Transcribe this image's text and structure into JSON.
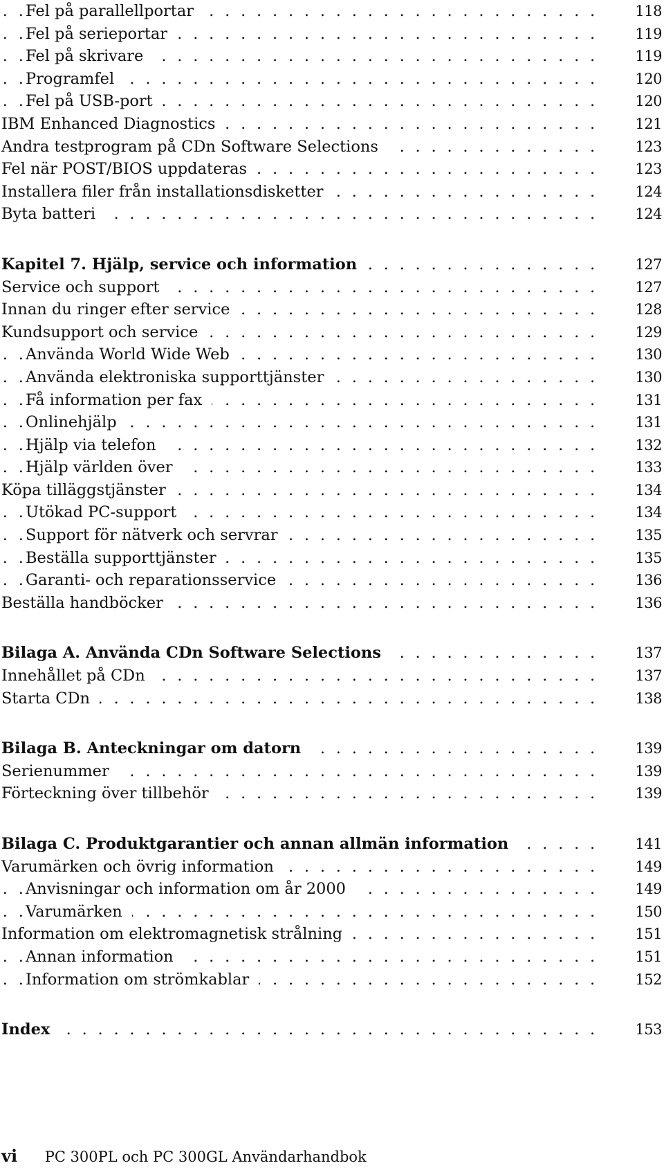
{
  "toc": {
    "entries": [
      {
        "title": "Fel på parallellportar",
        "page": "118",
        "level": 2,
        "heading": false,
        "gap_before": false
      },
      {
        "title": "Fel på serieportar",
        "page": "119",
        "level": 2,
        "heading": false,
        "gap_before": false
      },
      {
        "title": "Fel på skrivare",
        "page": "119",
        "level": 2,
        "heading": false,
        "gap_before": false
      },
      {
        "title": "Programfel",
        "page": "120",
        "level": 2,
        "heading": false,
        "gap_before": false
      },
      {
        "title": "Fel på USB-port",
        "page": "120",
        "level": 2,
        "heading": false,
        "gap_before": false
      },
      {
        "title": "IBM Enhanced Diagnostics",
        "page": "121",
        "level": 1,
        "heading": false,
        "gap_before": false
      },
      {
        "title": "Andra testprogram på CDn Software Selections",
        "page": "123",
        "level": 1,
        "heading": false,
        "gap_before": false
      },
      {
        "title": "Fel när POST/BIOS uppdateras",
        "page": "123",
        "level": 1,
        "heading": false,
        "gap_before": false
      },
      {
        "title": "Installera filer från installationsdisketter",
        "page": "124",
        "level": 1,
        "heading": false,
        "gap_before": false
      },
      {
        "title": "Byta batteri",
        "page": "124",
        "level": 1,
        "heading": false,
        "gap_before": false
      },
      {
        "title": "Kapitel 7.  Hjälp, service och information",
        "page": "127",
        "level": 1,
        "heading": true,
        "gap_before": true
      },
      {
        "title": "Service och support",
        "page": "127",
        "level": 1,
        "heading": false,
        "gap_before": false
      },
      {
        "title": "Innan du ringer efter service",
        "page": "128",
        "level": 1,
        "heading": false,
        "gap_before": false
      },
      {
        "title": "Kundsupport och service",
        "page": "129",
        "level": 1,
        "heading": false,
        "gap_before": false
      },
      {
        "title": "Använda World Wide Web",
        "page": "130",
        "level": 2,
        "heading": false,
        "gap_before": false
      },
      {
        "title": "Använda elektroniska supporttjänster",
        "page": "130",
        "level": 2,
        "heading": false,
        "gap_before": false
      },
      {
        "title": "Få information per fax",
        "page": "131",
        "level": 2,
        "heading": false,
        "gap_before": false
      },
      {
        "title": "Onlinehjälp",
        "page": "131",
        "level": 2,
        "heading": false,
        "gap_before": false
      },
      {
        "title": "Hjälp via telefon",
        "page": "132",
        "level": 2,
        "heading": false,
        "gap_before": false
      },
      {
        "title": "Hjälp världen över",
        "page": "133",
        "level": 2,
        "heading": false,
        "gap_before": false
      },
      {
        "title": "Köpa tilläggstjänster",
        "page": "134",
        "level": 1,
        "heading": false,
        "gap_before": false
      },
      {
        "title": "Utökad PC-support",
        "page": "134",
        "level": 2,
        "heading": false,
        "gap_before": false
      },
      {
        "title": "Support för nätverk och servrar",
        "page": "135",
        "level": 2,
        "heading": false,
        "gap_before": false
      },
      {
        "title": "Beställa supporttjänster",
        "page": "135",
        "level": 2,
        "heading": false,
        "gap_before": false
      },
      {
        "title": "Garanti- och reparationsservice",
        "page": "136",
        "level": 2,
        "heading": false,
        "gap_before": false
      },
      {
        "title": "Beställa handböcker",
        "page": "136",
        "level": 1,
        "heading": false,
        "gap_before": false
      },
      {
        "title": "Bilaga A.  Använda CDn Software Selections",
        "page": "137",
        "level": 1,
        "heading": true,
        "gap_before": true
      },
      {
        "title": "Innehållet på CDn",
        "page": "137",
        "level": 1,
        "heading": false,
        "gap_before": false
      },
      {
        "title": "Starta CDn",
        "page": "138",
        "level": 1,
        "heading": false,
        "gap_before": false
      },
      {
        "title": "Bilaga B.  Anteckningar om datorn",
        "page": "139",
        "level": 1,
        "heading": true,
        "gap_before": true
      },
      {
        "title": "Serienummer",
        "page": "139",
        "level": 1,
        "heading": false,
        "gap_before": false
      },
      {
        "title": "Förteckning över tillbehör",
        "page": "139",
        "level": 1,
        "heading": false,
        "gap_before": false
      },
      {
        "title": "Bilaga C.  Produktgarantier och annan allmän information",
        "page": "141",
        "level": 1,
        "heading": true,
        "gap_before": true
      },
      {
        "title": "Varumärken och övrig information",
        "page": "149",
        "level": 1,
        "heading": false,
        "gap_before": false
      },
      {
        "title": "Anvisningar och information om år 2000",
        "page": "149",
        "level": 2,
        "heading": false,
        "gap_before": false
      },
      {
        "title": "Varumärken",
        "page": "150",
        "level": 2,
        "heading": false,
        "gap_before": false
      },
      {
        "title": "Information om elektromagnetisk strålning",
        "page": "151",
        "level": 1,
        "heading": false,
        "gap_before": false
      },
      {
        "title": "Annan information",
        "page": "151",
        "level": 2,
        "heading": false,
        "gap_before": false
      },
      {
        "title": "Information om strömkablar",
        "page": "152",
        "level": 2,
        "heading": false,
        "gap_before": false
      },
      {
        "title": "Index",
        "page": "153",
        "level": 1,
        "heading": true,
        "gap_before": true
      }
    ],
    "leader_char": "."
  },
  "footer": {
    "folio": "vi",
    "book_title": "PC 300PL och PC 300GL Användarhandbok"
  }
}
